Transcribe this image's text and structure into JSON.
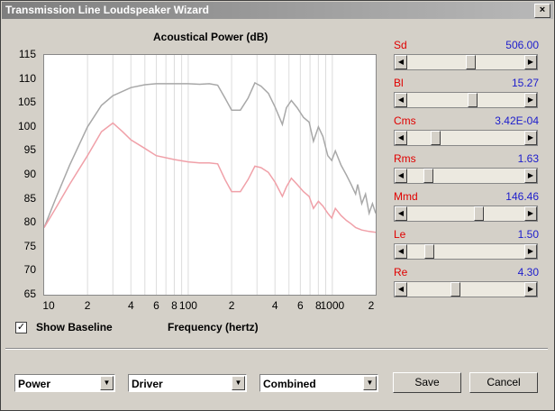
{
  "window": {
    "title": "Transmission Line Loudspeaker Wizard",
    "close_glyph": "×"
  },
  "chart_data": {
    "type": "line",
    "title": "Acoustical Power (dB)",
    "xlabel": "Frequency (hertz)",
    "ylabel": "",
    "x_scale": "log",
    "xlim": [
      10,
      2000
    ],
    "ylim": [
      65,
      115
    ],
    "yticks": [
      "115",
      "110",
      "105",
      "100",
      "95",
      "90",
      "85",
      "80",
      "75",
      "70",
      "65"
    ],
    "xticks": [
      "10",
      "2",
      "4",
      "6",
      "8",
      "100",
      "2",
      "4",
      "6",
      "8",
      "1000",
      "2"
    ],
    "series": [
      {
        "color": "#a8a8a8",
        "points": [
          [
            10,
            79
          ],
          [
            12,
            85
          ],
          [
            15,
            92
          ],
          [
            20,
            100
          ],
          [
            25,
            104.5
          ],
          [
            30,
            106.5
          ],
          [
            40,
            108.2
          ],
          [
            50,
            108.8
          ],
          [
            60,
            109
          ],
          [
            80,
            109
          ],
          [
            100,
            109
          ],
          [
            120,
            108.9
          ],
          [
            140,
            109
          ],
          [
            160,
            108.7
          ],
          [
            180,
            106
          ],
          [
            200,
            103.5
          ],
          [
            230,
            103.5
          ],
          [
            260,
            106
          ],
          [
            290,
            109.2
          ],
          [
            320,
            108.5
          ],
          [
            360,
            107
          ],
          [
            400,
            104.2
          ],
          [
            450,
            100.5
          ],
          [
            480,
            104
          ],
          [
            520,
            105.5
          ],
          [
            570,
            104
          ],
          [
            630,
            102
          ],
          [
            690,
            101
          ],
          [
            740,
            97
          ],
          [
            800,
            100
          ],
          [
            860,
            98
          ],
          [
            930,
            94
          ],
          [
            990,
            93
          ],
          [
            1050,
            95
          ],
          [
            1150,
            92
          ],
          [
            1250,
            90
          ],
          [
            1350,
            88
          ],
          [
            1450,
            86
          ],
          [
            1500,
            88
          ],
          [
            1600,
            84
          ],
          [
            1700,
            86
          ],
          [
            1800,
            82
          ],
          [
            1900,
            84
          ],
          [
            2000,
            82
          ]
        ]
      },
      {
        "color": "#f0a0a8",
        "points": [
          [
            10,
            79
          ],
          [
            12,
            83
          ],
          [
            15,
            88
          ],
          [
            20,
            94
          ],
          [
            25,
            99
          ],
          [
            30,
            100.8
          ],
          [
            35,
            99
          ],
          [
            40,
            97.3
          ],
          [
            50,
            95.5
          ],
          [
            60,
            94
          ],
          [
            80,
            93.2
          ],
          [
            100,
            92.7
          ],
          [
            120,
            92.5
          ],
          [
            140,
            92.5
          ],
          [
            160,
            92.3
          ],
          [
            180,
            89
          ],
          [
            200,
            86.5
          ],
          [
            230,
            86.5
          ],
          [
            260,
            89
          ],
          [
            290,
            91.8
          ],
          [
            320,
            91.5
          ],
          [
            360,
            90.5
          ],
          [
            400,
            88.5
          ],
          [
            450,
            85.5
          ],
          [
            480,
            87.5
          ],
          [
            520,
            89.3
          ],
          [
            570,
            88
          ],
          [
            630,
            86.5
          ],
          [
            690,
            85.5
          ],
          [
            740,
            83
          ],
          [
            800,
            84.5
          ],
          [
            860,
            83.5
          ],
          [
            930,
            82
          ],
          [
            990,
            81
          ],
          [
            1050,
            83
          ],
          [
            1150,
            81.5
          ],
          [
            1250,
            80.5
          ],
          [
            1350,
            79.8
          ],
          [
            1450,
            79
          ],
          [
            1600,
            78.5
          ],
          [
            1800,
            78.2
          ],
          [
            2000,
            78
          ]
        ]
      }
    ]
  },
  "show_baseline": {
    "label": "Show Baseline",
    "checked": true,
    "check_glyph": "✓"
  },
  "params": [
    {
      "name": "Sd",
      "value": "506.00",
      "position": 0.55
    },
    {
      "name": "Bl",
      "value": "15.27",
      "position": 0.56
    },
    {
      "name": "Cms",
      "value": "3.42E-04",
      "position": 0.22
    },
    {
      "name": "Rms",
      "value": "1.63",
      "position": 0.15
    },
    {
      "name": "Mmd",
      "value": "146.46",
      "position": 0.62
    },
    {
      "name": "Le",
      "value": "1.50",
      "position": 0.16
    },
    {
      "name": "Re",
      "value": "4.30",
      "position": 0.4
    }
  ],
  "combos": {
    "left": "Power",
    "middle": "Driver",
    "right": "Combined"
  },
  "buttons": {
    "save": "Save",
    "cancel": "Cancel"
  },
  "icons": {
    "left_arrow": "◀",
    "right_arrow": "▶",
    "down_arrow": "▼"
  }
}
